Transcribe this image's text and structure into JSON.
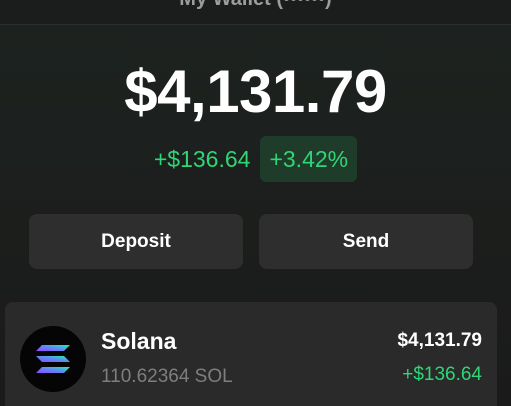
{
  "header": {
    "title": "My Wallet (••••••)"
  },
  "portfolio": {
    "balance": "$4,131.79",
    "change_amount": "+$136.64",
    "change_percent": "+3.42%"
  },
  "actions": {
    "deposit_label": "Deposit",
    "send_label": "Send"
  },
  "tokens": [
    {
      "name": "Solana",
      "amount": "110.62364 SOL",
      "value": "$4,131.79",
      "change": "+$136.64",
      "icon": "solana-logo-icon"
    }
  ],
  "colors": {
    "positive": "#2fd675",
    "positive_bg": "#1f3b2a",
    "button_bg": "#2e2e2e",
    "card_bg": "#2a2a2a"
  }
}
